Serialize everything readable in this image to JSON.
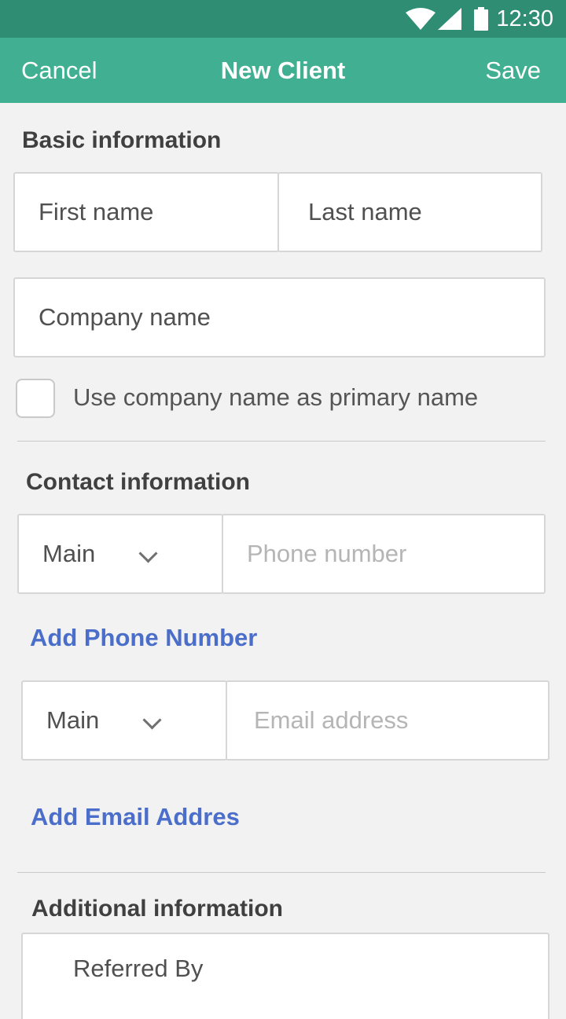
{
  "status": {
    "time": "12:30",
    "icons": [
      "wifi-icon",
      "signal-icon",
      "battery-icon"
    ]
  },
  "header": {
    "cancel_label": "Cancel",
    "title": "New Client",
    "save_label": "Save"
  },
  "basic": {
    "title": "Basic information",
    "first_name_placeholder": "First name",
    "last_name_placeholder": "Last name",
    "company_placeholder": "Company name",
    "use_company_label": "Use company name as primary name",
    "use_company_checked": false
  },
  "contact": {
    "title": "Contact information",
    "phone_type": "Main",
    "phone_placeholder": "Phone number",
    "add_phone_label": "Add Phone Number",
    "email_type": "Main",
    "email_placeholder": "Email address",
    "add_email_label": "Add Email Addres"
  },
  "additional": {
    "title": "Additional information",
    "referred_by_placeholder": "Referred By"
  },
  "colors": {
    "statusbar": "#2f8d74",
    "appbar": "#41af91",
    "link": "#4a6ec9",
    "background": "#f2f2f2"
  }
}
